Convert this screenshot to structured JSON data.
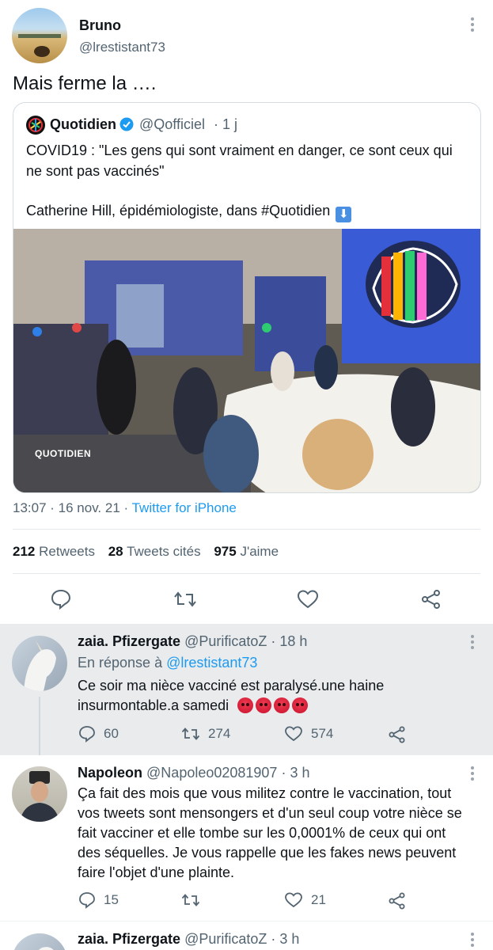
{
  "main_tweet": {
    "name": "Bruno",
    "handle": "@lrestistant73",
    "text": "Mais ferme la ….",
    "quote": {
      "name": "Quotidien",
      "handle": "@Qofficiel",
      "time": "· 1 j",
      "line1": "COVID19 : \"Les gens qui sont vraiment en danger, ce sont ceux qui",
      "line2": "ne sont pas vaccinés\"",
      "line3": "Catherine Hill, épidémiologiste, dans #Quotidien",
      "watermark": "QUOTIDIEN"
    },
    "meta": {
      "time_date": "13:07 · 16 nov. 21 ·",
      "source": "Twitter for iPhone"
    },
    "stats": {
      "retweets_count": "212",
      "retweets_label": "Retweets",
      "quotes_count": "28",
      "quotes_label": "Tweets cités",
      "likes_count": "975",
      "likes_label": "J'aime"
    }
  },
  "replies": [
    {
      "name": "zaia. Pfizergate",
      "handle": "@PurificatoZ",
      "time": "· 18 h",
      "reply_to_prefix": "En réponse à",
      "reply_to_handle": "@lrestistant73",
      "line1": "Ce soir ma nièce vacciné est paralysé.une haine",
      "line2": "insurmontable.a samedi",
      "replies": "60",
      "retweets": "274",
      "likes": "574"
    },
    {
      "name": "Napoleon",
      "handle": "@Napoleo02081907",
      "time": "· 3 h",
      "line1": "Ça fait des mois que vous militez contre le vaccination, tout",
      "line2": "vos tweets sont mensongers et d'un seul coup votre nièce se",
      "line3": "fait vacciner et elle tombe sur les 0,0001% de ceux qui ont",
      "line4": "des séquelles. Je vous rappelle que les fakes news peuvent",
      "line5": "faire l'objet d'une plainte.",
      "replies": "15",
      "retweets": "",
      "likes": "21"
    },
    {
      "name": "zaia. Pfizergate",
      "handle": "@PurificatoZ",
      "time": "· 3 h"
    }
  ],
  "colors": {
    "accent": "#1d9bf0",
    "highlight_bg": "#e9ebed",
    "text_secondary": "#536471"
  }
}
